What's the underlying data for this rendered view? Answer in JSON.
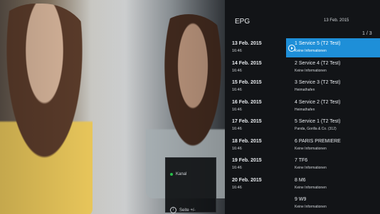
{
  "epg": {
    "title": "EPG",
    "date": "13 Feb. 2015",
    "pager": "1 / 3",
    "rows": [
      {
        "date": "13 Feb. 2015",
        "time": "16:46",
        "channel": "1 Service 5 (T2 Test)",
        "program": "Keine Informationen",
        "selected": true
      },
      {
        "date": "14 Feb. 2015",
        "time": "16:46",
        "channel": "2 Service 4 (T2 Test)",
        "program": "Keine Informationen"
      },
      {
        "date": "15 Feb. 2015",
        "time": "16:46",
        "channel": "3 Service 3 (T2 Test)",
        "program": "Heimathafen"
      },
      {
        "date": "16 Feb. 2015",
        "time": "16:46",
        "channel": "4 Service 2 (T2 Test)",
        "program": "Heimathafen"
      },
      {
        "date": "17 Feb. 2015",
        "time": "16:46",
        "channel": "5 Service 1 (T2 Test)",
        "program": "Panda, Gorilla & Co. (312)"
      },
      {
        "date": "18 Feb. 2015",
        "time": "16:46",
        "channel": "6 PARIS PREMIERE",
        "program": "Keine Informationen"
      },
      {
        "date": "19 Feb. 2015",
        "time": "16:46",
        "channel": "7 TF6",
        "program": "Keine Informationen"
      },
      {
        "date": "20 Feb. 2015",
        "time": "16:46",
        "channel": "8 M6",
        "program": "Keine Informationen"
      },
      {
        "date": "",
        "time": "",
        "channel": "9 W9",
        "program": "Keine Informationen"
      }
    ]
  },
  "legend": {
    "kanal_label": "Kanal",
    "seite_label": "Seite +/-",
    "kanal_color": "#28c04a"
  },
  "colors": {
    "highlight": "#1e8fd8",
    "panel": "#121417"
  }
}
